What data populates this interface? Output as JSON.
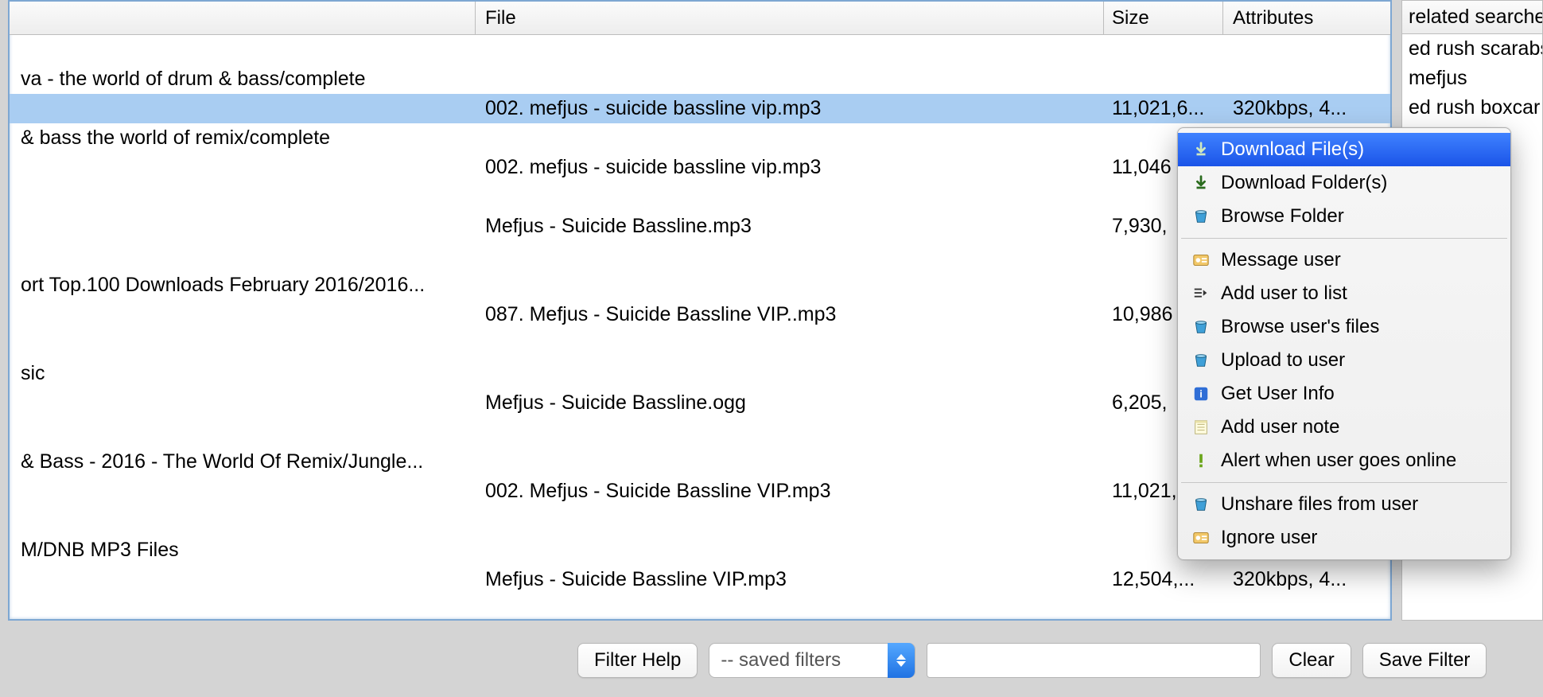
{
  "columns": {
    "file": "File",
    "size": "Size",
    "attr": "Attributes"
  },
  "rows": [
    {
      "type": "blank"
    },
    {
      "type": "folder",
      "left": "va - the world of drum & bass/complete"
    },
    {
      "type": "file",
      "selected": true,
      "file": "002. mefjus - suicide bassline vip.mp3",
      "size": "11,021,6...",
      "attr": "320kbps, 4..."
    },
    {
      "type": "folder",
      "left": "& bass the world of remix/complete"
    },
    {
      "type": "file",
      "file": "002. mefjus - suicide bassline vip.mp3",
      "size": "11,046"
    },
    {
      "type": "blank"
    },
    {
      "type": "file",
      "file": "Mefjus - Suicide Bassline.mp3",
      "size": "7,930,"
    },
    {
      "type": "blank"
    },
    {
      "type": "folder",
      "left": "ort Top.100 Downloads February 2016/2016..."
    },
    {
      "type": "file",
      "file": "087. Mefjus - Suicide Bassline VIP..mp3",
      "size": "10,986"
    },
    {
      "type": "blank"
    },
    {
      "type": "folder",
      "left": "sic"
    },
    {
      "type": "file",
      "file": "Mefjus - Suicide Bassline.ogg",
      "size": "6,205,"
    },
    {
      "type": "blank"
    },
    {
      "type": "folder",
      "left": "& Bass - 2016 - The World Of Remix/Jungle..."
    },
    {
      "type": "file",
      "file": "002. Mefjus - Suicide Bassline VIP.mp3",
      "size": "11,021,"
    },
    {
      "type": "blank"
    },
    {
      "type": "folder",
      "left": "M/DNB MP3 Files"
    },
    {
      "type": "file",
      "file": "Mefjus - Suicide Bassline VIP.mp3",
      "size": "12,504,...",
      "attr": "320kbps, 4..."
    }
  ],
  "side": {
    "header": "related searches",
    "items": [
      "ed rush scarabs",
      "mefjus",
      "ed rush boxcar"
    ]
  },
  "menu": {
    "items": [
      {
        "icon": "arrow-green",
        "label": "Download File(s)",
        "hl": true
      },
      {
        "icon": "arrow-green",
        "label": "Download Folder(s)"
      },
      {
        "icon": "cup",
        "label": "Browse Folder"
      },
      {
        "sep": true
      },
      {
        "icon": "user-card",
        "label": "Message user"
      },
      {
        "icon": "list-arrow",
        "label": "Add user to list"
      },
      {
        "icon": "cup",
        "label": "Browse user's files"
      },
      {
        "icon": "cup",
        "label": "Upload to user"
      },
      {
        "icon": "info",
        "label": "Get User Info"
      },
      {
        "icon": "note",
        "label": "Add user note"
      },
      {
        "icon": "excl",
        "label": "Alert when user goes online"
      },
      {
        "sep": true
      },
      {
        "icon": "cup",
        "label": "Unshare files from user"
      },
      {
        "icon": "user-card",
        "label": "Ignore user"
      }
    ]
  },
  "bottom": {
    "filter_help": "Filter Help",
    "saved_filters": "-- saved filters",
    "clear": "Clear",
    "save_filter": "Save Filter"
  }
}
